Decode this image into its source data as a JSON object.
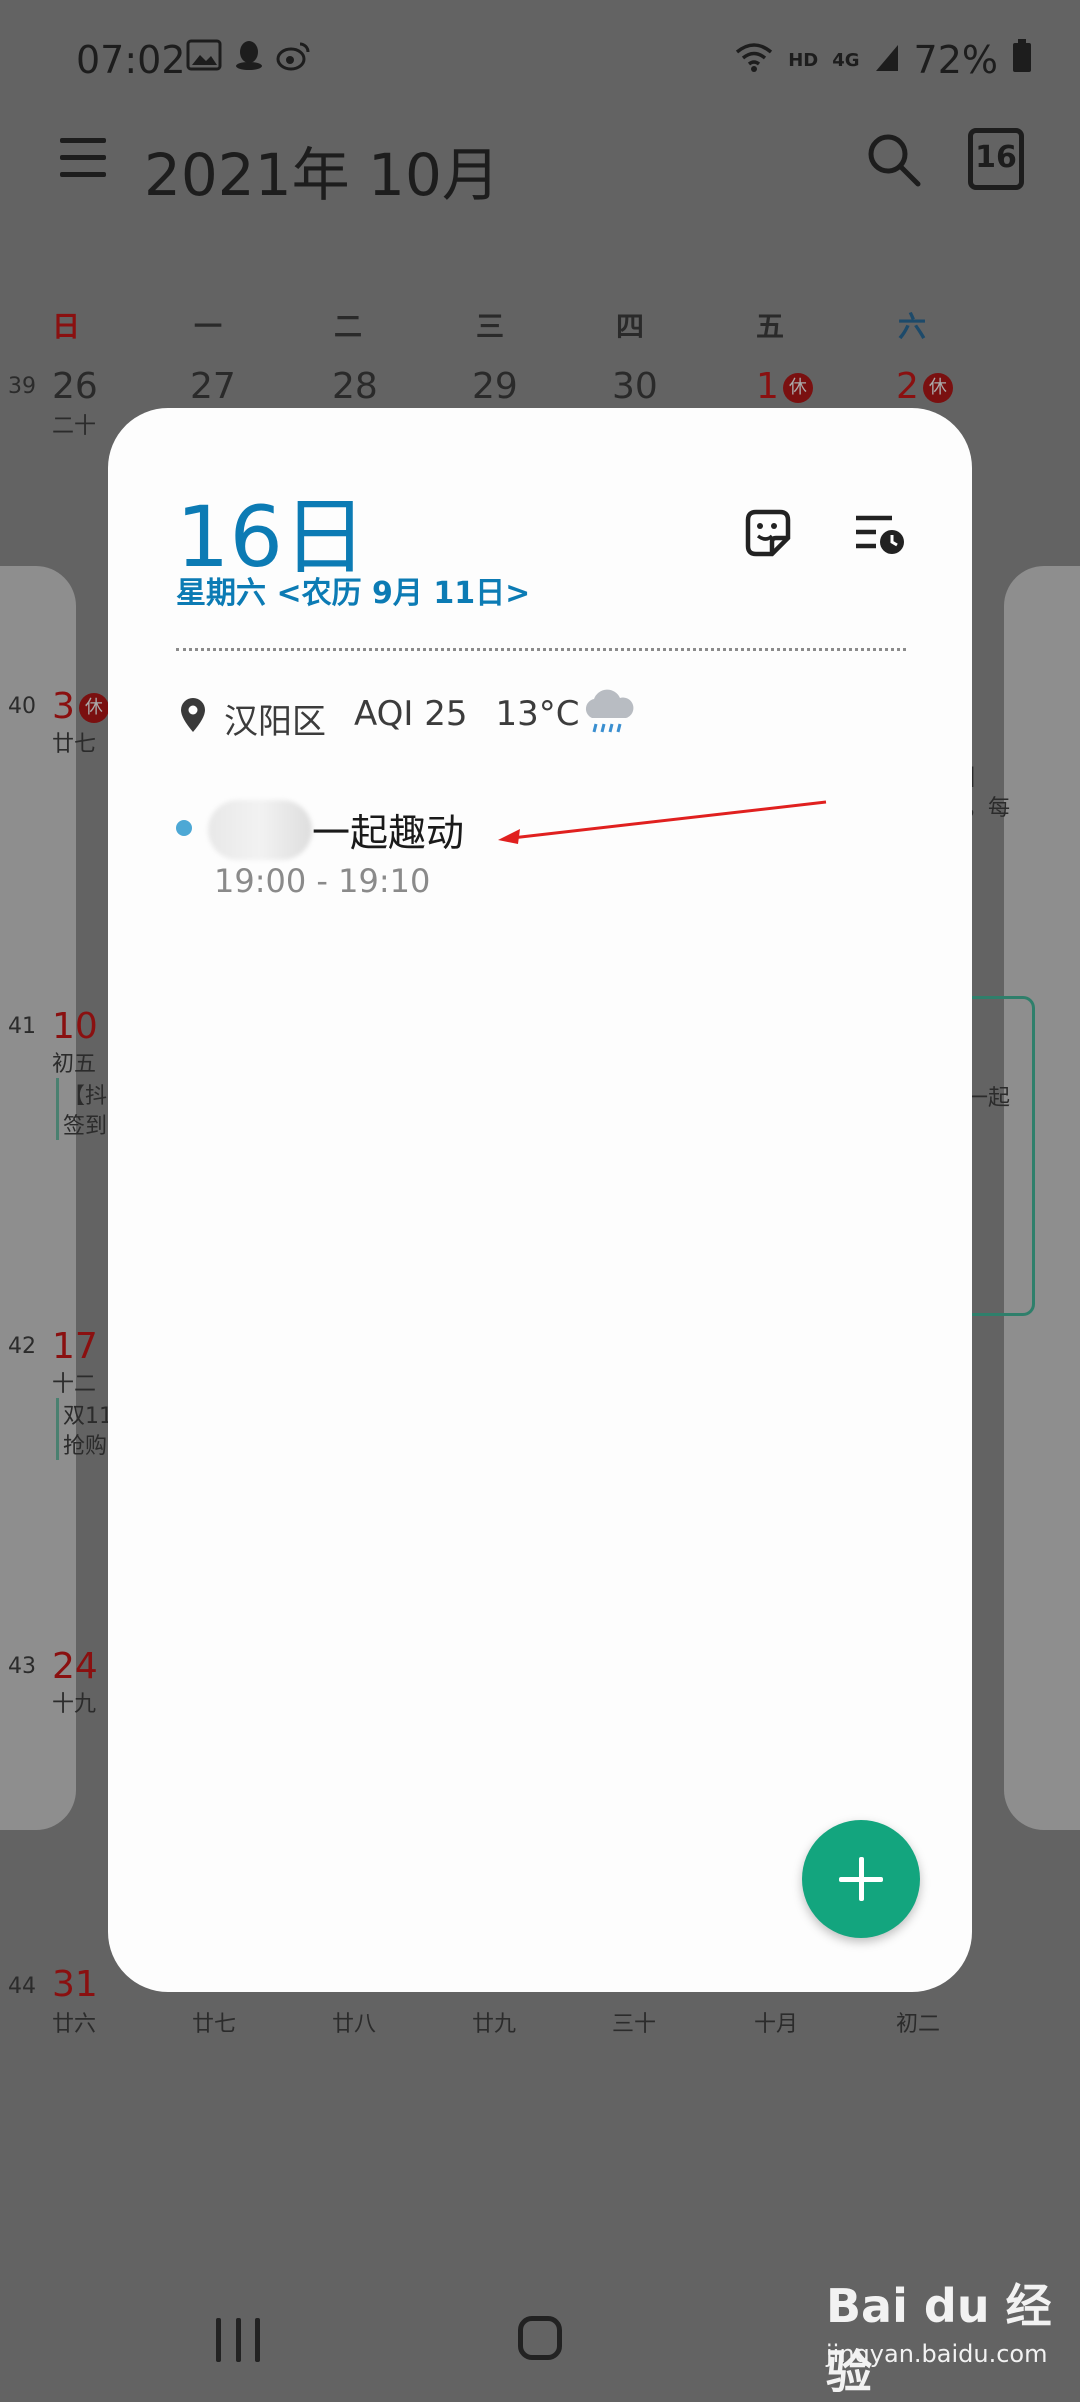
{
  "status": {
    "time": "07:02",
    "network": "HD",
    "signal": "4G",
    "battery": "72%"
  },
  "header": {
    "title": "2021年  10月",
    "today_day": "16"
  },
  "weekdays": [
    "日",
    "一",
    "二",
    "三",
    "四",
    "五",
    "六"
  ],
  "background": {
    "row1": {
      "week": "39",
      "days": [
        "26",
        "27",
        "28",
        "29",
        "30",
        "1",
        "2"
      ],
      "lunar": "二十",
      "holiday_badge": "休"
    },
    "row2": {
      "week": "40",
      "day": "3",
      "lunar": "廿七",
      "holiday_badge": "休"
    },
    "row3": {
      "week": "41",
      "day": "10",
      "lunar": "初五",
      "ev1": "【抖",
      "ev2": "签到"
    },
    "row4": {
      "week": "42",
      "day": "17",
      "lunar": "十二",
      "ev1": "双11",
      "ev2": "抢购"
    },
    "row5": {
      "week": "43",
      "day": "24",
      "lunar": "十九"
    },
    "row6": {
      "week": "44",
      "day": "31",
      "lunar": "廿六",
      "lunars": [
        "廿七",
        "廿八",
        "廿九",
        "三十",
        "十月",
        "初二"
      ]
    },
    "right_fragments": {
      "a": "】",
      "b": "，每",
      "c": "一起"
    }
  },
  "popup": {
    "date": "16日",
    "subtitle": "星期六 <农历 9月 11日>",
    "weather": {
      "location": "汉阳区",
      "aqi": "AQI 25",
      "temp": "13°C"
    },
    "event": {
      "title": "一起趣动",
      "time": "19:00 - 19:10"
    }
  },
  "watermark": {
    "brand": "Bai du 经验",
    "url": "jingyan.baidu.com"
  },
  "colors": {
    "accent": "#0c7bb4",
    "fab": "#13a57e",
    "event_dot": "#4da8d5",
    "arrow": "#e0201f"
  }
}
